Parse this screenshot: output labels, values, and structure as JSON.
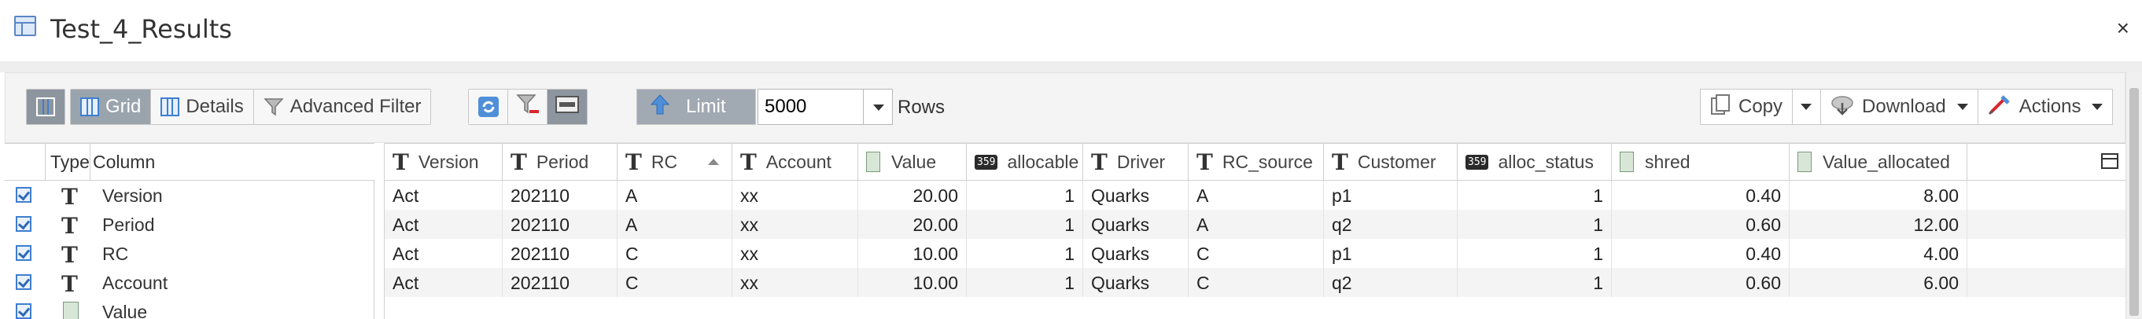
{
  "window": {
    "title": "Test_4_Results",
    "close": "×"
  },
  "toolbar": {
    "grid": "Grid",
    "details": "Details",
    "advanced_filter": "Advanced Filter",
    "limit": "Limit",
    "limit_value": "5000",
    "rows": "Rows",
    "copy": "Copy",
    "download": "Download",
    "actions": "Actions"
  },
  "left_panel": {
    "headers": {
      "type": "Type",
      "column": "Column"
    },
    "rows": [
      {
        "name": "Version",
        "type": "T"
      },
      {
        "name": "Period",
        "type": "T"
      },
      {
        "name": "RC",
        "type": "T"
      },
      {
        "name": "Account",
        "type": "T"
      },
      {
        "name": "Value",
        "type": "calc"
      }
    ]
  },
  "grid": {
    "columns": [
      {
        "label": "Version",
        "icon": "T"
      },
      {
        "label": "Period",
        "icon": "T"
      },
      {
        "label": "RC",
        "icon": "T",
        "sorted": "asc"
      },
      {
        "label": "Account",
        "icon": "T"
      },
      {
        "label": "Value",
        "icon": "calc"
      },
      {
        "label": "allocable",
        "icon": "359"
      },
      {
        "label": "Driver",
        "icon": "T"
      },
      {
        "label": "RC_source",
        "icon": "T"
      },
      {
        "label": "Customer",
        "icon": "T"
      },
      {
        "label": "alloc_status",
        "icon": "359"
      },
      {
        "label": "shred",
        "icon": "calc"
      },
      {
        "label": "Value_allocated",
        "icon": "calc"
      }
    ],
    "rows": [
      [
        "Act",
        "202110",
        "A",
        "xx",
        "20.00",
        "1",
        "Quarks",
        "A",
        "p1",
        "1",
        "0.40",
        "8.00"
      ],
      [
        "Act",
        "202110",
        "A",
        "xx",
        "20.00",
        "1",
        "Quarks",
        "A",
        "q2",
        "1",
        "0.60",
        "12.00"
      ],
      [
        "Act",
        "202110",
        "C",
        "xx",
        "10.00",
        "1",
        "Quarks",
        "C",
        "p1",
        "1",
        "0.40",
        "4.00"
      ],
      [
        "Act",
        "202110",
        "C",
        "xx",
        "10.00",
        "1",
        "Quarks",
        "C",
        "q2",
        "1",
        "0.60",
        "6.00"
      ]
    ]
  }
}
